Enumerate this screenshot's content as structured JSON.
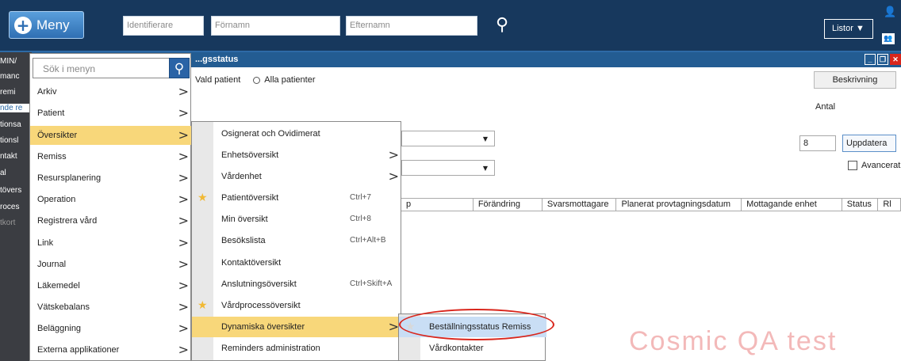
{
  "topbar": {
    "menu_label": "Meny",
    "identifierare_placeholder": "Identifierare",
    "fornamn_placeholder": "Förnamn",
    "efternamn_placeholder": "Efternamn",
    "listor_label": "Listor ▼"
  },
  "sidebar_left": {
    "lines": [
      "MIN/",
      "manc",
      "remi",
      "nde re",
      "tionsa",
      "tionsl",
      "ntakt",
      "al",
      "tövers",
      "roces",
      "tkort"
    ]
  },
  "window": {
    "title": "...gsstatus",
    "radio_vald": "Vald patient",
    "radio_alla": "Alla patienter",
    "beskrivning": "Beskrivning",
    "antal_label": "Antal",
    "antal_value": "8",
    "uppdatera": "Uppdatera",
    "avancerat": "Avancerat",
    "columns": [
      "p",
      "Förändring",
      "Svarsmottagare",
      "Planerat provtagningsdatum",
      "Mottagande enhet",
      "Status",
      "Rl"
    ]
  },
  "menu": {
    "search_placeholder": "Sök i menyn",
    "items": [
      {
        "label": "Arkiv"
      },
      {
        "label": "Patient"
      },
      {
        "label": "Översikter"
      },
      {
        "label": "Remiss"
      },
      {
        "label": "Resursplanering"
      },
      {
        "label": "Operation"
      },
      {
        "label": "Registrera vård"
      },
      {
        "label": "Link"
      },
      {
        "label": "Journal"
      },
      {
        "label": "Läkemedel"
      },
      {
        "label": "Vätskebalans"
      },
      {
        "label": "Beläggning"
      },
      {
        "label": "Externa applikationer"
      }
    ]
  },
  "submenu": {
    "items": [
      {
        "label": "Osignerat och Ovidimerat",
        "shortcut": ""
      },
      {
        "label": "Enhetsöversikt",
        "shortcut": ""
      },
      {
        "label": "Vårdenhet",
        "shortcut": ""
      },
      {
        "label": "Patientöversikt",
        "shortcut": "Ctrl+7"
      },
      {
        "label": "Min översikt",
        "shortcut": "Ctrl+8"
      },
      {
        "label": "Besökslista",
        "shortcut": "Ctrl+Alt+B"
      },
      {
        "label": "Kontaktöversikt",
        "shortcut": ""
      },
      {
        "label": "Anslutningsöversikt",
        "shortcut": "Ctrl+Skift+A"
      },
      {
        "label": "Vårdprocessöversikt",
        "shortcut": ""
      },
      {
        "label": "Dynamiska översikter",
        "shortcut": ""
      },
      {
        "label": "Reminders administration",
        "shortcut": ""
      }
    ]
  },
  "submenu2": {
    "items": [
      {
        "label": "Beställningsstatus Remiss"
      },
      {
        "label": "Vårdkontakter"
      }
    ]
  },
  "watermark": "Cosmic QA test"
}
